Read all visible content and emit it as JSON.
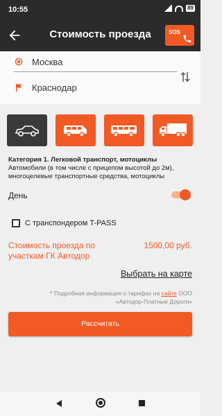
{
  "status": {
    "time": "10:55",
    "battery": "89"
  },
  "header": {
    "title": "Стоимость проезда",
    "sos_label": "SOS"
  },
  "route": {
    "from": "Москва",
    "to": "Краснодар"
  },
  "vehicles": [
    {
      "icon": "car-icon",
      "selected": true
    },
    {
      "icon": "minibus-icon",
      "selected": false
    },
    {
      "icon": "bus-icon",
      "selected": false
    },
    {
      "icon": "truck-icon",
      "selected": false
    }
  ],
  "category": {
    "title": "Категория 1. Легковой транспорт, мотоциклы",
    "description": "Автомобили (в том числе с прицепом высотой до 2м), многоцелевые транспортные средства, мотоциклы"
  },
  "time_of_day": {
    "label": "День",
    "enabled": true
  },
  "transponder": {
    "label": "С транспондером T-PASS",
    "checked": false
  },
  "cost": {
    "label": "Стоимость проезда по участкам ГК Автодор",
    "value": "1500,00 руб."
  },
  "map_link": "Выбрать на карте",
  "note": {
    "prefix": "* Подробная информация о тарифах на ",
    "link": "сайте",
    "suffix": " ООО «Автодор-Платные Дороги»"
  },
  "calculate_button": "Рассчитать",
  "colors": {
    "accent": "#f15a24",
    "dark": "#2b2b2b",
    "background": "#efefef"
  }
}
